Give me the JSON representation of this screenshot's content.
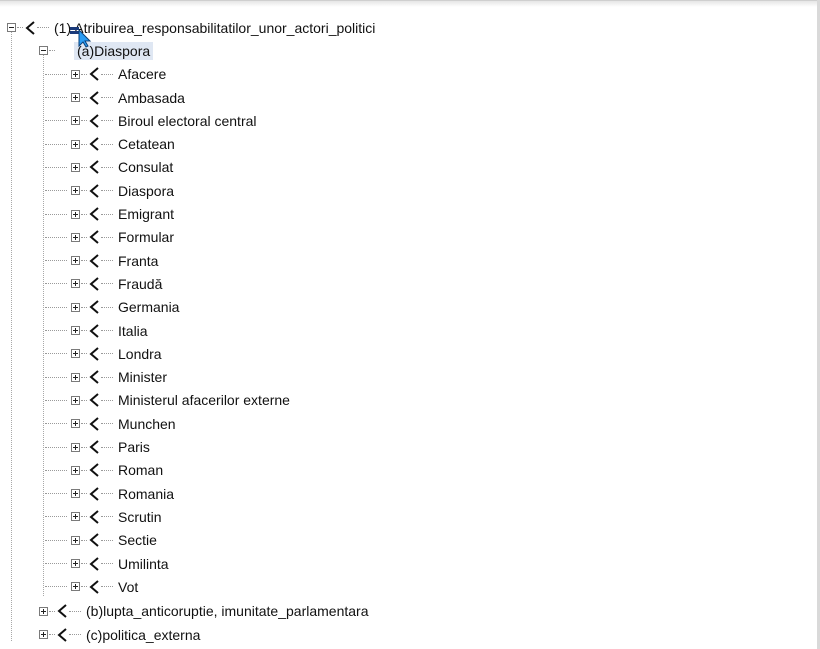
{
  "tree": {
    "root": {
      "label": "(1) Atribuirea_responsabilitatilor_unor_actori_politici",
      "icon": "speaker-icon",
      "expanded": true
    },
    "selected_node": {
      "label": "(a)Diaspora",
      "icon": "cursor-pointer-icon",
      "expanded": true
    },
    "children": [
      "Afacere",
      "Ambasada",
      "Biroul electoral central",
      "Cetatean",
      "Consulat",
      "Diaspora",
      "Emigrant",
      "Formular",
      "Franta",
      "Fraudă",
      "Germania",
      "Italia",
      "Londra",
      "Minister",
      "Ministerul afacerilor externe",
      "Munchen",
      "Paris",
      "Roman",
      "Romania",
      "Scrutin",
      "Sectie",
      "Umilinta",
      "Vot"
    ],
    "siblings": [
      {
        "label": "(b)lupta_anticoruptie, imunitate_parlamentara",
        "icon": "speaker-icon",
        "expanded": false
      },
      {
        "label": "(c)politica_externa",
        "icon": "speaker-icon",
        "expanded": false
      }
    ],
    "colors": {
      "selection": "#dfe7f3",
      "cursor": "#2a9df4",
      "icon_dark": "#101010"
    }
  }
}
